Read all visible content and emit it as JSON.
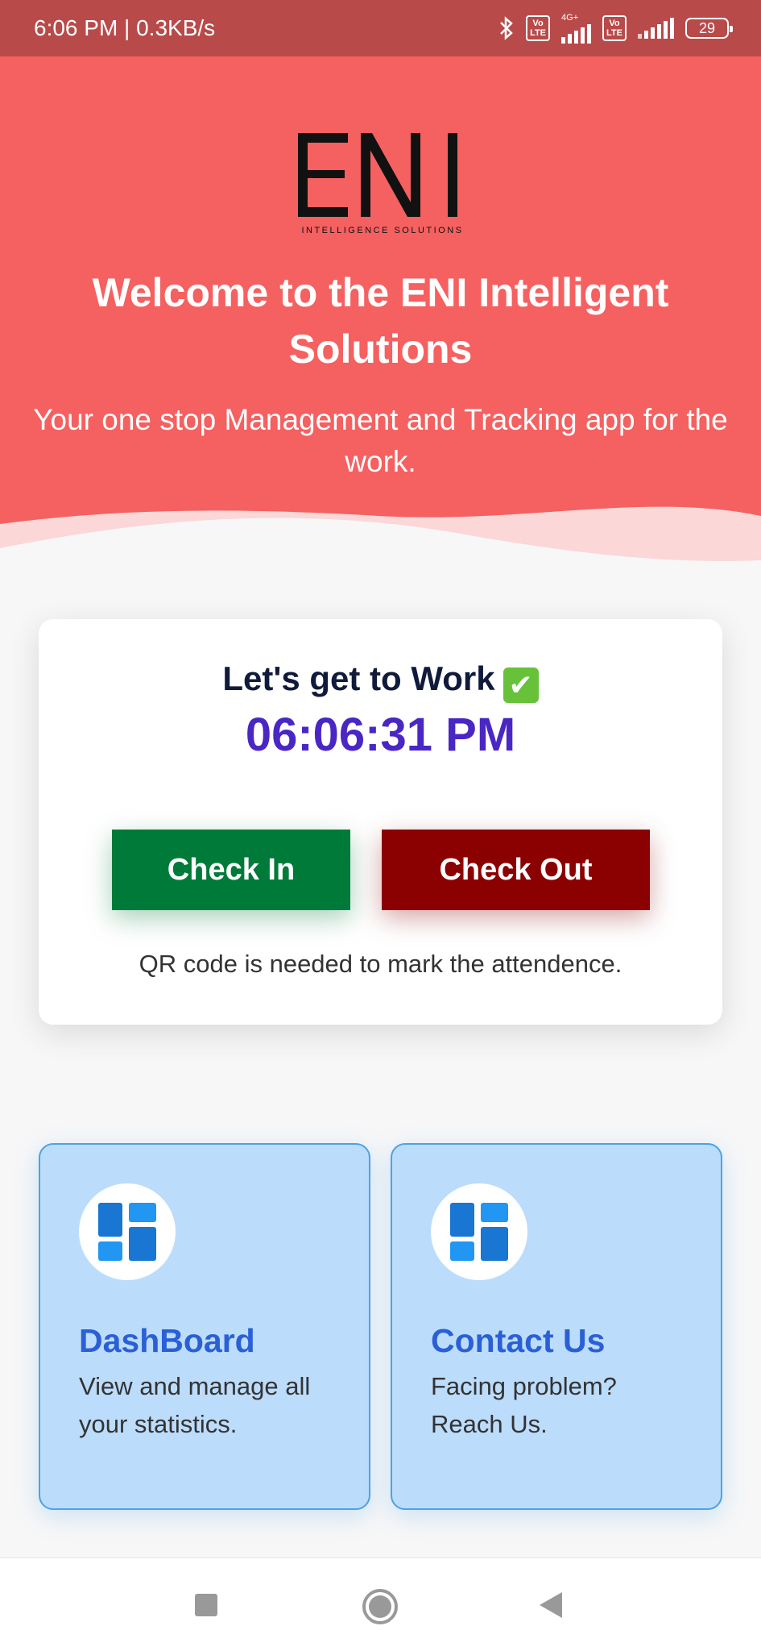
{
  "status_bar": {
    "time_speed": "6:06 PM | 0.3KB/s",
    "volte_label": "Vo\nLTE",
    "network_label": "4G+",
    "battery": "29",
    "icons": [
      "bluetooth-icon",
      "volte-icon",
      "signal-icon",
      "volte-icon",
      "signal-icon",
      "battery-icon"
    ]
  },
  "header": {
    "logo_text": "ENI",
    "logo_subtitle": "INTELLIGENCE SOLUTIONS",
    "title": "Welcome to the ENI Intelligent Solutions",
    "subtitle": "Your one stop Management and Tracking app for the work."
  },
  "work_card": {
    "title": "Let's get to Work",
    "title_emoji": "✔",
    "clock": "06:06:31 PM",
    "check_in_label": "Check In",
    "check_out_label": "Check Out",
    "note": "QR code is needed to mark the attendence."
  },
  "tiles": [
    {
      "title": "DashBoard",
      "description": "View and manage all your statistics.",
      "icon": "dashboard-icon"
    },
    {
      "title": "Contact Us",
      "description": "Facing problem? Reach Us.",
      "icon": "dashboard-icon"
    }
  ],
  "colors": {
    "header": "#f56060",
    "status_bar": "#b84a4a",
    "check_in": "#007a38",
    "check_out": "#8b0000",
    "clock": "#4a27c4",
    "tile_bg": "#bcdcfb",
    "tile_title": "#2a5fd6"
  },
  "nav_bar": {
    "icons": [
      "recent-apps-icon",
      "home-icon",
      "back-icon"
    ]
  }
}
